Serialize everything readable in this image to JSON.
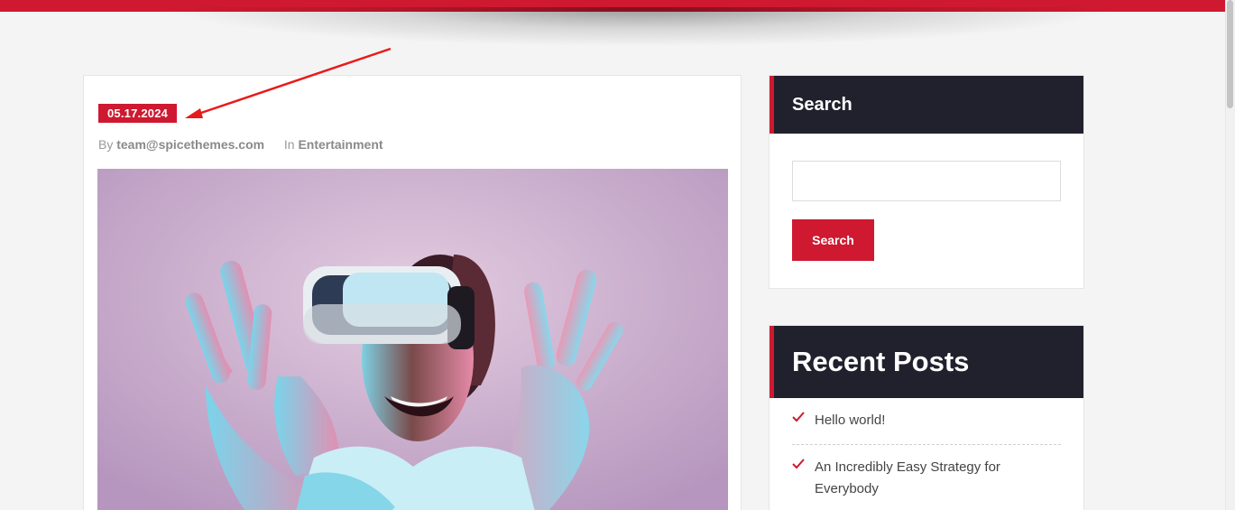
{
  "post": {
    "date": "05.17.2024",
    "meta": {
      "by_label": "By",
      "author": "team@spicethemes.com",
      "in_label": "In",
      "category": "Entertainment"
    },
    "image_description_icon": "vr-headset-woman-photo"
  },
  "sidebar": {
    "search": {
      "title": "Search",
      "input_placeholder": "",
      "button_label": "Search"
    },
    "recent_posts": {
      "title": "Recent Posts",
      "items": [
        {
          "label": "Hello world!",
          "icon": "check-icon"
        },
        {
          "label": "An Incredibly Easy Strategy for Everybody",
          "icon": "check-icon"
        }
      ]
    }
  },
  "colors": {
    "accent": "#ce1930",
    "widget_header_bg": "#21202d",
    "page_bg": "#f4f4f4"
  }
}
